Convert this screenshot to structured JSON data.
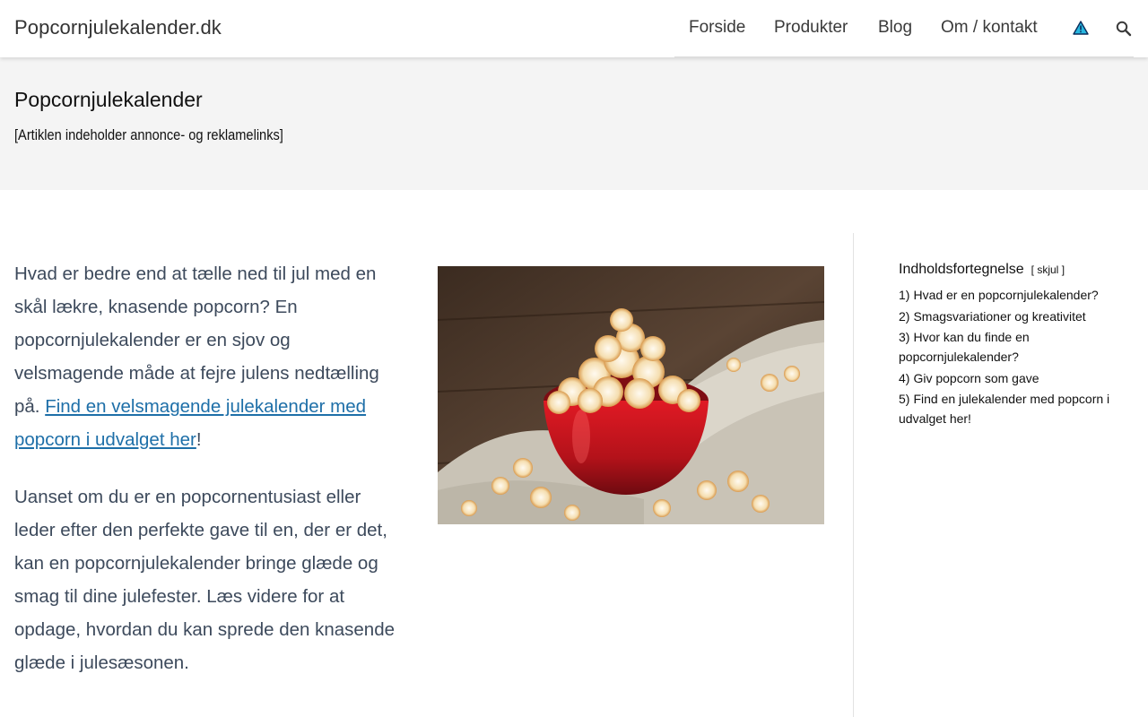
{
  "header": {
    "site_title": "Popcornjulekalender.dk",
    "nav": [
      {
        "label": "Forside"
      },
      {
        "label": "Produkter"
      },
      {
        "label": "Blog"
      },
      {
        "label": "Om / kontakt"
      }
    ],
    "icons": [
      "warning-icon",
      "search-icon"
    ]
  },
  "title_band": {
    "title": "Popcornjulekalender",
    "disclaimer": "[Artiklen indeholder annonce- og reklamelinks]"
  },
  "content": {
    "p1_text": "Hvad er bedre end at tælle ned til jul med en skål lækre, knasende popcorn? En popcornjulekalender er en sjov og velsmagende måde at fejre julens nedtælling på. ",
    "p1_link": "Find en velsmagende julekalender med popcorn i udvalget her",
    "p1_end": "!",
    "p2_text": "Uanset om du er en popcornentusiast eller leder efter den perfekte gave til en, der er det, kan en popcornjulekalender bringe glæde og smag til dine julefester. Læs videre for at opdage, hvordan du kan sprede den knasende glæde i julesæsonen."
  },
  "toc": {
    "title": "Indholdsfortegnelse",
    "toggle_open": "[",
    "toggle_label": "skjul",
    "toggle_close": "]",
    "items": [
      {
        "num": "1)",
        "label": "Hvad er en popcornjulekalender?"
      },
      {
        "num": "2)",
        "label": "Smagsvariationer og kreativitet"
      },
      {
        "num": "3)",
        "label": "Hvor kan du finde en popcornjulekalender?"
      },
      {
        "num": "4)",
        "label": "Giv popcorn som gave"
      },
      {
        "num": "5)",
        "label": "Find en julekalender med popcorn i udvalget her!"
      }
    ]
  },
  "colors": {
    "link": "#1e6fa8",
    "title_band_bg": "#f4f4f4",
    "body_text": "#3d4a5c"
  }
}
